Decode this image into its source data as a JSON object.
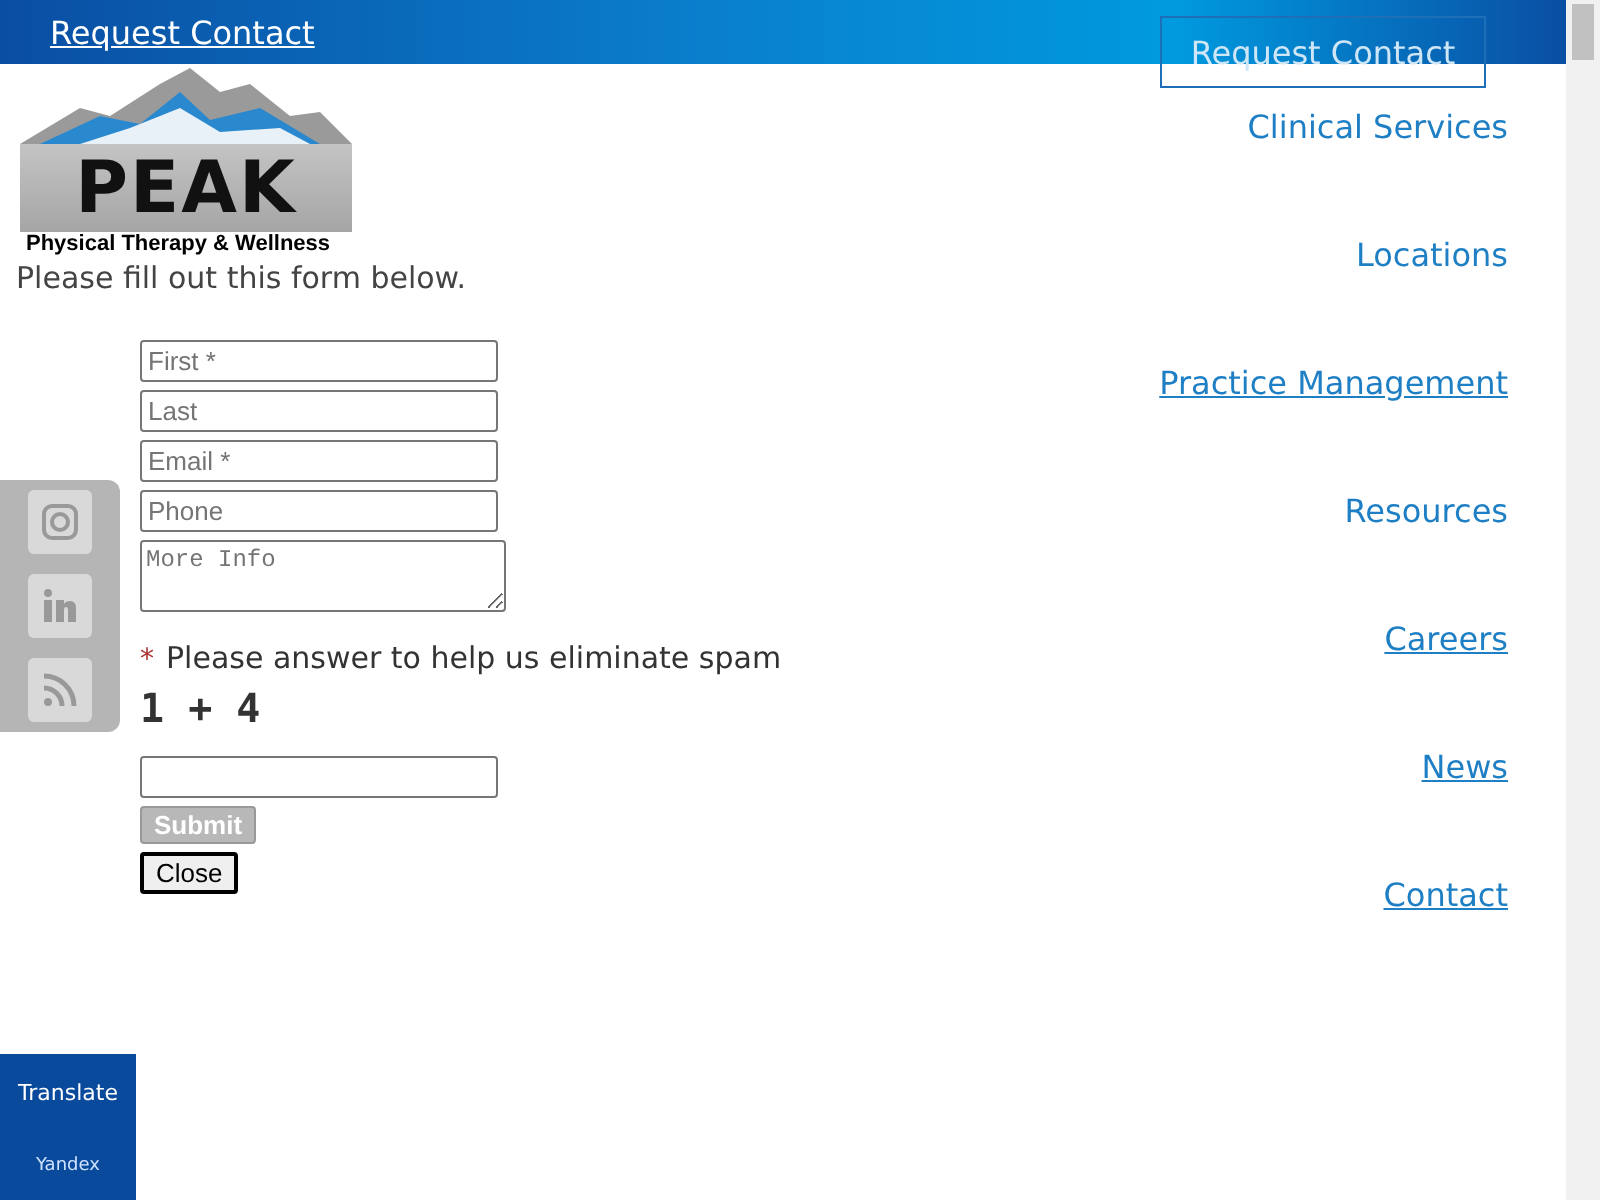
{
  "top_bar": {
    "link": "Request Contact",
    "ghost_button": "Request Contact"
  },
  "logo": {
    "wordmark": "PEAK",
    "tagline": "Physical Therapy & Wellness"
  },
  "intro": "Please fill out this form below.",
  "form": {
    "fields": [
      {
        "placeholder": "First *",
        "kind": "input"
      },
      {
        "placeholder": "Last",
        "kind": "input"
      },
      {
        "placeholder": "Email *",
        "kind": "input"
      },
      {
        "placeholder": "Phone",
        "kind": "input"
      },
      {
        "placeholder": "More Info",
        "kind": "textarea"
      }
    ],
    "required_mark": "*",
    "spam_prompt": "Please answer to help us eliminate spam",
    "captcha": "1 + 4",
    "buttons": [
      {
        "label": "Submit",
        "disabled": true
      },
      {
        "label": "Close",
        "disabled": false
      }
    ]
  },
  "nav": [
    {
      "label": "Clinical Services",
      "underlined": false
    },
    {
      "label": "Locations",
      "underlined": false
    },
    {
      "label": "Practice Management",
      "underlined": true
    },
    {
      "label": "Resources",
      "underlined": false
    },
    {
      "label": "Careers",
      "underlined": true
    },
    {
      "label": "News",
      "underlined": true
    },
    {
      "label": "Contact",
      "underlined": true
    }
  ],
  "social": [
    {
      "kind": "instagram"
    },
    {
      "kind": "linkedin"
    },
    {
      "kind": "rss"
    }
  ],
  "translate": {
    "title": "Translate",
    "provider": "Yandex"
  }
}
